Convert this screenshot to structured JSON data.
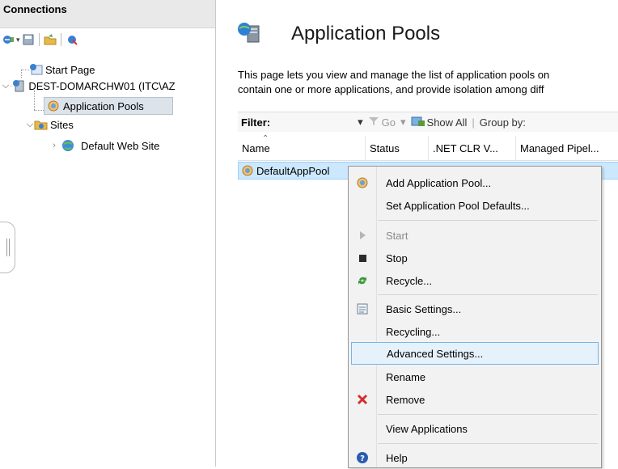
{
  "connections": {
    "title": "Connections",
    "toolbar": [
      {
        "icon": "connect-icon"
      },
      {
        "icon": "save-icon"
      },
      {
        "icon": "open-folder-icon"
      },
      {
        "icon": "disconnect-icon"
      }
    ],
    "tree": {
      "start_page": "Start Page",
      "server": "DEST-DOMARCHW01 (ITC\\AZ",
      "app_pools": "Application Pools",
      "sites": "Sites",
      "default_site": "Default Web Site"
    }
  },
  "main": {
    "title": "Application Pools",
    "description_line1": "This page lets you view and manage the list of application pools on",
    "description_line2": "contain one or more applications, and provide isolation among diff",
    "filter": {
      "label": "Filter:",
      "go": "Go",
      "show_all": "Show All",
      "group_by": "Group by:"
    },
    "columns": [
      "Name",
      "Status",
      ".NET CLR V...",
      "Managed Pipel..."
    ],
    "rows": [
      {
        "name": "DefaultAppPool"
      }
    ]
  },
  "context_menu": {
    "items": [
      {
        "label": "Add Application Pool...",
        "icon": "add-pool-icon"
      },
      {
        "label": "Set Application Pool Defaults...",
        "icon": ""
      },
      {
        "label": "Start",
        "icon": "play-icon",
        "disabled": true
      },
      {
        "label": "Stop",
        "icon": "stop-icon"
      },
      {
        "label": "Recycle...",
        "icon": "recycle-icon"
      },
      {
        "label": "Basic Settings...",
        "icon": "settings-icon"
      },
      {
        "label": "Recycling...",
        "icon": ""
      },
      {
        "label": "Advanced Settings...",
        "icon": "",
        "highlighted": true
      },
      {
        "label": "Rename",
        "icon": ""
      },
      {
        "label": "Remove",
        "icon": "remove-icon"
      },
      {
        "label": "View Applications",
        "icon": ""
      },
      {
        "label": "Help",
        "icon": "help-icon"
      }
    ]
  },
  "colors": {
    "selection": "#cce8ff",
    "menu_highlight": "#e5f1fb",
    "remove": "#d32f2f",
    "recycle": "#3a9a3a",
    "help": "#2a5db0"
  }
}
